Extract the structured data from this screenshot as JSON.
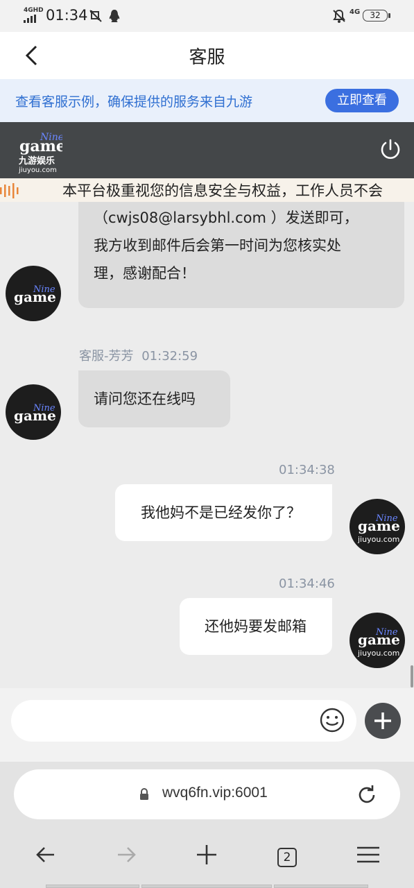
{
  "status_bar": {
    "network": "4GHD",
    "time": "01:34",
    "net_type": "4G",
    "battery": "32"
  },
  "header": {
    "title": "客服"
  },
  "notice": {
    "text": "查看客服示例，确保提供的服务来自九游",
    "button": "立即查看"
  },
  "brand": {
    "logo_top": "Nine",
    "logo_main": "game",
    "logo_cn": "九游娱乐",
    "logo_site": "jiuyou.com"
  },
  "marquee": {
    "text": "本平台极重视您的信息安全与权益，工作人员不会"
  },
  "chat": {
    "messages": [
      {
        "side": "left",
        "lines": [
          "（cwjs08@larsybhl.com ）发送即可，",
          "我方收到邮件后会第一时间为您核实处",
          "理，感谢配合！"
        ]
      },
      {
        "side": "left",
        "sender": "客服-芳芳",
        "time": "01:32:59",
        "text": "请问您还在线吗"
      },
      {
        "side": "right",
        "time": "01:34:38",
        "text": "我他妈不是已经发你了？"
      },
      {
        "side": "right",
        "time": "01:34:46",
        "text": "还他妈要发邮箱"
      }
    ]
  },
  "input": {
    "placeholder": ""
  },
  "browser": {
    "url": "wvq6fn.vip:6001",
    "tab_count": "2"
  },
  "colors": {
    "accent": "#3b6fe0",
    "notice_text": "#2f6fd1",
    "brand_bar": "#444749"
  }
}
